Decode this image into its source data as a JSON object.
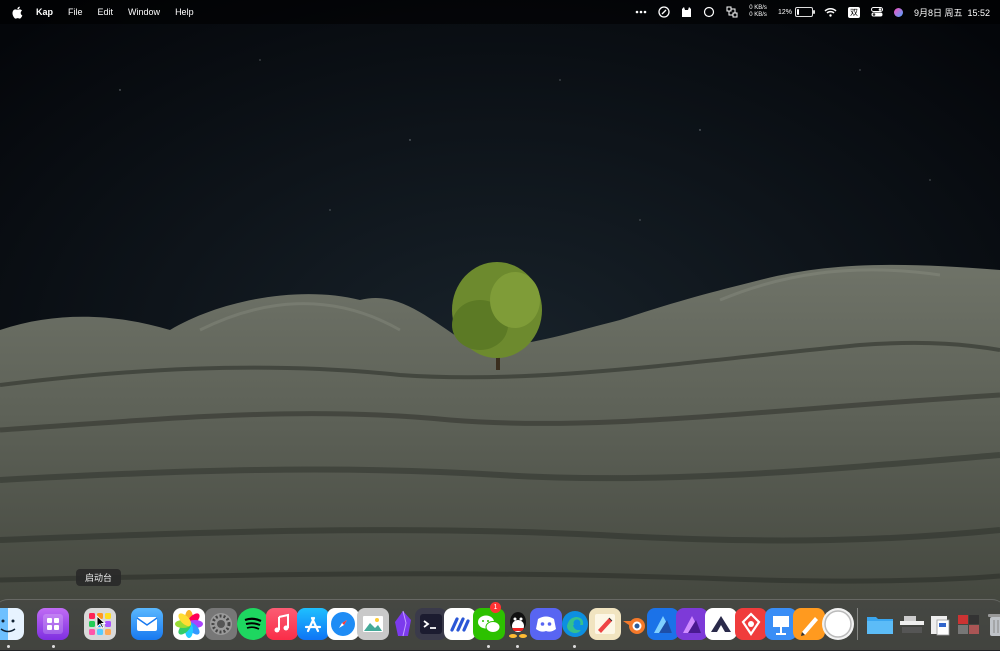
{
  "menubar": {
    "app_name": "Kap",
    "menus": [
      "File",
      "Edit",
      "Window",
      "Help"
    ],
    "net_up": "0 KB/s",
    "net_down": "0 KB/s",
    "battery_percent": "12%",
    "battery_level": 0.12,
    "input_method": "双",
    "datetime": "9月8日 周五  15:52",
    "icons": [
      "apple-icon",
      "more-icon",
      "clipboard-icon",
      "cat-icon",
      "circle-icon",
      "shortcut-icon",
      "battery-icon",
      "wifi-icon",
      "control-center-icon",
      "siri-icon"
    ]
  },
  "tooltip": {
    "text": "启动台"
  },
  "dock": {
    "apps": [
      "Finder",
      "Notion Calendar",
      "Launchpad",
      "Mail",
      "Photos",
      "System Settings",
      "Spotify",
      "Music",
      "App Store",
      "Safari",
      "Preview",
      "Obsidian",
      "Terminal",
      "Monday",
      "WeChat",
      "QQ",
      "Discord",
      "Microsoft Edge",
      "Notes",
      "Blender",
      "Affinity Designer",
      "Affinity Photo",
      "Vectornator",
      "Teambition",
      "Keynote",
      "Pages",
      "Clock",
      "Finder Folder",
      "Shelf",
      "Preview Docs",
      "Downloads",
      "Trash"
    ],
    "wechat_badge": "1"
  }
}
